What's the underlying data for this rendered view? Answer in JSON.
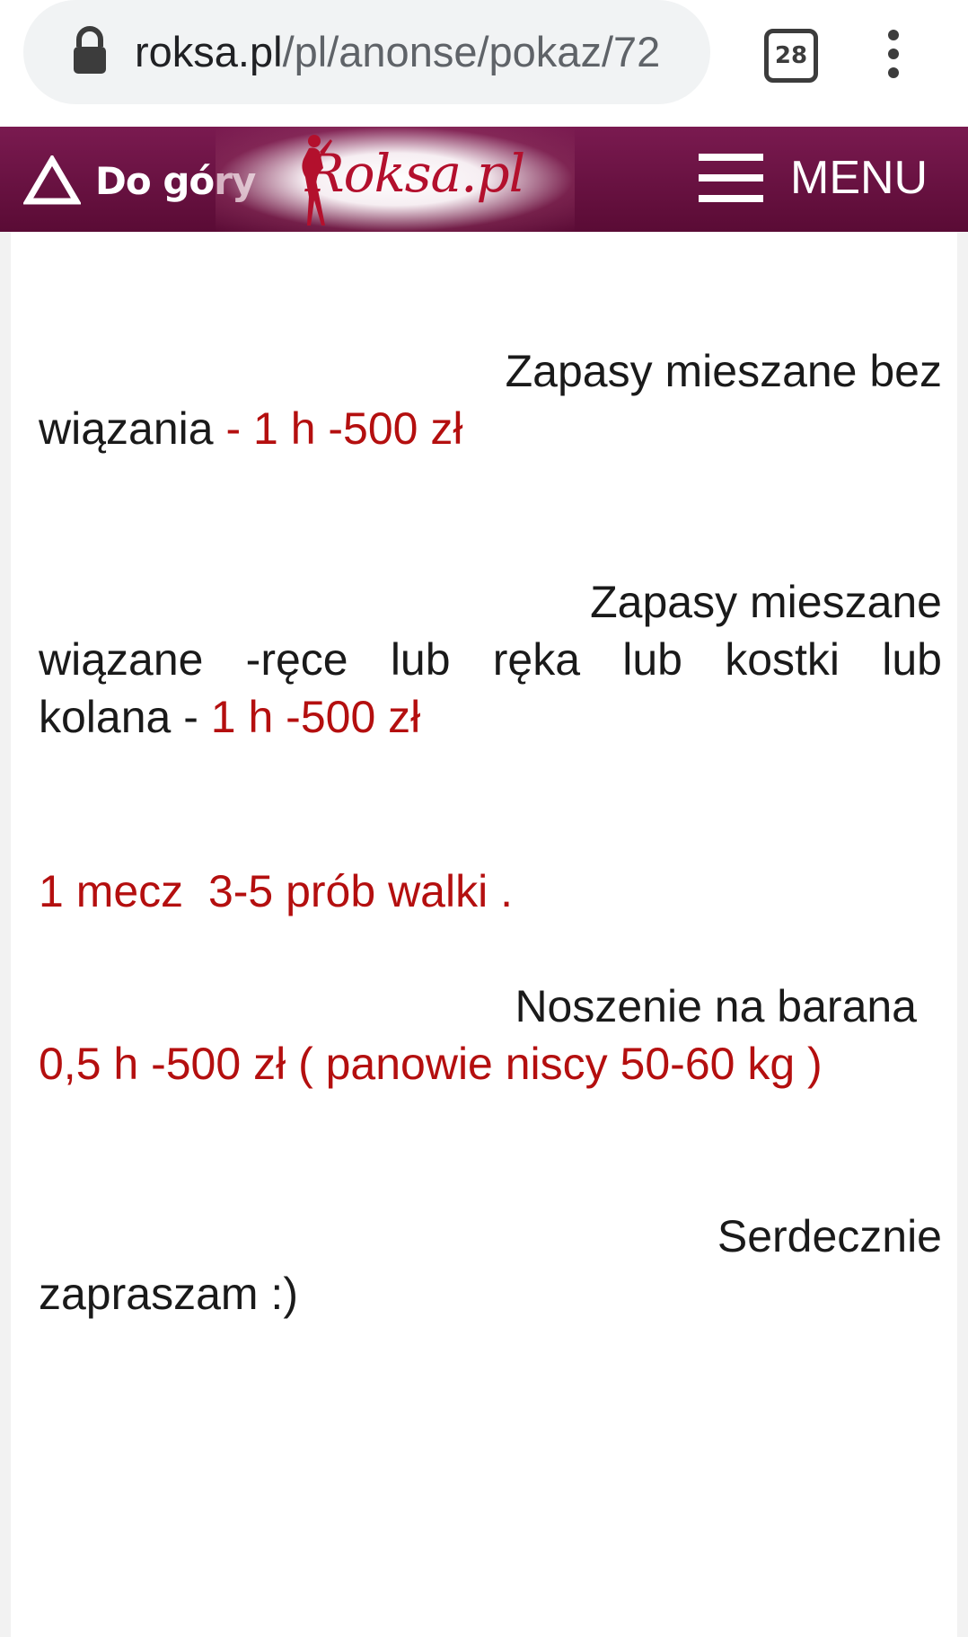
{
  "browser": {
    "url_host": "roksa.pl",
    "url_path": "/pl/anonse/pokaz/72",
    "tab_count": "28",
    "icons": {
      "lock": "lock-icon",
      "menu": "more-vert-icon"
    }
  },
  "header": {
    "scroll_top_label": "Do góry",
    "logo_text": "Roksa.pl",
    "menu_label": "MENU",
    "colors": {
      "bar": "#6b1242",
      "logo_red": "#b3102d"
    }
  },
  "content": {
    "item1": {
      "line1": "Zapasy mieszane bez",
      "line2_black": "wiązania",
      "line2_red": " - 1 h -500 zł"
    },
    "item2": {
      "line1": "Zapasy mieszane",
      "line2_words": [
        "wiązane",
        "-ręce",
        "lub",
        "ręka",
        "lub",
        "kostki",
        "lub"
      ],
      "line3_black": "kolana - ",
      "line3_red": "1 h -500 zł"
    },
    "item3": {
      "red_line": "1 mecz  3-5 prób walki ."
    },
    "item4": {
      "line1": "Noszenie na barana",
      "line2_red": "0,5 h -500 zł ( panowie niscy 50-60 kg )"
    },
    "item5": {
      "line1": "Serdecznie",
      "line2": "zapraszam :)"
    },
    "colors": {
      "text": "#1a1a1a",
      "price_red": "#b40f0f"
    }
  }
}
